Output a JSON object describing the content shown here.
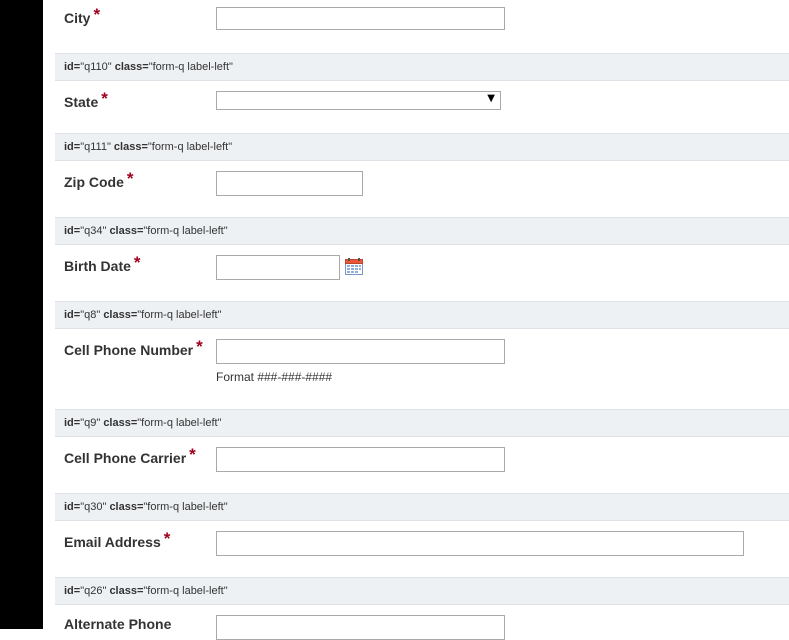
{
  "fields": {
    "city": {
      "label": "City",
      "required": "*"
    },
    "state": {
      "label": "State",
      "required": "*",
      "selected": ""
    },
    "zip": {
      "label": "Zip Code",
      "required": "*"
    },
    "birth": {
      "label": "Birth Date",
      "required": "*"
    },
    "cell": {
      "label": "Cell Phone Number",
      "required": "*",
      "hint": "Format ###-###-####"
    },
    "carrier": {
      "label": "Cell Phone Carrier",
      "required": "*"
    },
    "email": {
      "label": "Email Address",
      "required": "*"
    },
    "alt": {
      "label": "Alternate Phone"
    }
  },
  "strips": [
    {
      "id_key": "id=",
      "id_val": "\"q110\"",
      "class_key": "class=",
      "class_val": "\"form-q label-left\""
    },
    {
      "id_key": "id=",
      "id_val": "\"q111\"",
      "class_key": "class=",
      "class_val": "\"form-q label-left\""
    },
    {
      "id_key": "id=",
      "id_val": "\"q34\"",
      "class_key": "class=",
      "class_val": "\"form-q label-left\""
    },
    {
      "id_key": "id=",
      "id_val": "\"q8\"",
      "class_key": "class=",
      "class_val": "\"form-q label-left\""
    },
    {
      "id_key": "id=",
      "id_val": "\"q9\"",
      "class_key": "class=",
      "class_val": "\"form-q label-left\""
    },
    {
      "id_key": "id=",
      "id_val": "\"q30\"",
      "class_key": "class=",
      "class_val": "\"form-q label-left\""
    },
    {
      "id_key": "id=",
      "id_val": "\"q26\"",
      "class_key": "class=",
      "class_val": "\"form-q label-left\""
    }
  ],
  "icons": {
    "calendar": "calendar-icon",
    "select_arrow": "chevron-down-icon"
  },
  "colors": {
    "required": "#a0001c",
    "strip_bg": "#eef1f4",
    "sidebar": "#000000"
  }
}
